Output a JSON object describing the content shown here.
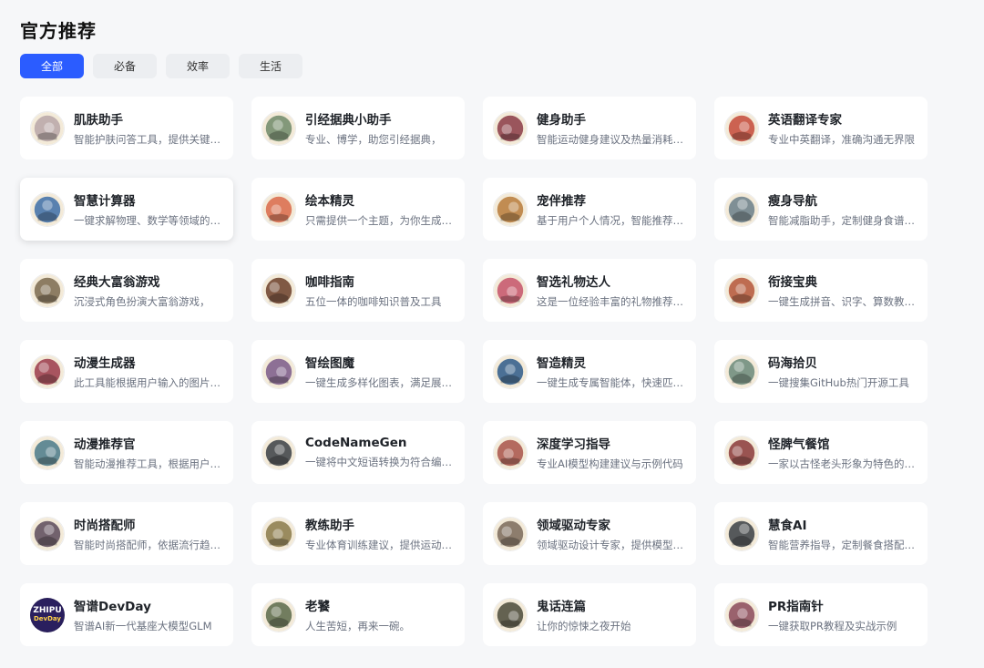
{
  "page": {
    "title": "官方推荐"
  },
  "tabs": [
    {
      "label": "全部",
      "active": true
    },
    {
      "label": "必备",
      "active": false
    },
    {
      "label": "效率",
      "active": false
    },
    {
      "label": "生活",
      "active": false
    }
  ],
  "cards": [
    {
      "name": "肌肤助手",
      "desc": "智能护肤问答工具，提供关键皮肤问题解答",
      "icon": "skin-care-icon",
      "color": "#b7a6a8"
    },
    {
      "name": "引经据典小助手",
      "desc": "专业、博学，助您引经据典，",
      "icon": "landscape-icon",
      "color": "#6f8a6a"
    },
    {
      "name": "健身助手",
      "desc": "智能运动健身建议及热量消耗计算",
      "icon": "fitness-icon",
      "color": "#8a3b47"
    },
    {
      "name": "英语翻译专家",
      "desc": "专业中英翻译，准确沟通无界限",
      "icon": "translate-icon",
      "color": "#c44a3a"
    },
    {
      "name": "智慧计算器",
      "desc": "一键求解物理、数学等领域的问题",
      "icon": "calculator-icon",
      "color": "#3d6ea8"
    },
    {
      "name": "绘本精灵",
      "desc": "只需提供一个主题，为你生成绘本",
      "icon": "picture-book-icon",
      "color": "#d96a4a"
    },
    {
      "name": "宠伴推荐",
      "desc": "基于用户个人情况，智能推荐宠物",
      "icon": "pet-icon",
      "color": "#b77b3b"
    },
    {
      "name": "瘦身导航",
      "desc": "智能减脂助手，定制健身食谱计划",
      "icon": "slim-icon",
      "color": "#6a7f8a"
    },
    {
      "name": "经典大富翁游戏",
      "desc": "沉浸式角色扮演大富翁游戏，",
      "icon": "monopoly-icon",
      "color": "#7a6a4f"
    },
    {
      "name": "咖啡指南",
      "desc": "五位一体的咖啡知识普及工具",
      "icon": "coffee-icon",
      "color": "#6b3f2a"
    },
    {
      "name": "智选礼物达人",
      "desc": "这是一位经验丰富的礼物推荐专家",
      "icon": "gift-icon",
      "color": "#c4536a"
    },
    {
      "name": "衔接宝典",
      "desc": "一键生成拼音、识字、算数教学材料",
      "icon": "textbook-icon",
      "color": "#b4563a"
    },
    {
      "name": "动漫生成器",
      "desc": "此工具能根据用户输入的图片生成动漫",
      "icon": "anime-generator-icon",
      "color": "#9a3a4a"
    },
    {
      "name": "智绘图魔",
      "desc": "一键生成多样化图表，满足展示需求",
      "icon": "chart-magic-icon",
      "color": "#7a5a8a"
    },
    {
      "name": "智造精灵",
      "desc": "一键生成专属智能体，快速匹配需求",
      "icon": "elf-icon",
      "color": "#2d5a8a"
    },
    {
      "name": "码海拾贝",
      "desc": "一键搜集GitHub热门开源工具",
      "icon": "shell-icon",
      "color": "#6a8a7a"
    },
    {
      "name": "动漫推荐官",
      "desc": "智能动漫推荐工具，根据用户喜好推荐",
      "icon": "anime-recommend-icon",
      "color": "#4a7a8a"
    },
    {
      "name": "CodeNameGen",
      "desc": "一键将中文短语转换为符合编程规范的命名",
      "icon": "code-icon",
      "color": "#3a3f45"
    },
    {
      "name": "深度学习指导",
      "desc": "专业AI模型构建建议与示例代码",
      "icon": "deep-learning-icon",
      "color": "#a8534a"
    },
    {
      "name": "怪脾气餐馆",
      "desc": "一家以古怪老头形象为特色的餐馆",
      "icon": "restaurant-icon",
      "color": "#8a3a3a"
    },
    {
      "name": "时尚搭配师",
      "desc": "智能时尚搭配师，依据流行趋势推荐",
      "icon": "fashion-icon",
      "color": "#5a4a5a"
    },
    {
      "name": "教练助手",
      "desc": "专业体育训练建议，提供运动指导",
      "icon": "coach-icon",
      "color": "#8a7a4a"
    },
    {
      "name": "领域驱动专家",
      "desc": "领域驱动设计专家，提供模型设计建议",
      "icon": "domain-icon",
      "color": "#7a6a5a"
    },
    {
      "name": "慧食AI",
      "desc": "智能营养指导，定制餐食搭配方案",
      "icon": "food-icon",
      "color": "#3a3f45"
    },
    {
      "name": "智谱DevDay",
      "desc": "智谱AI新一代基座大模型GLM",
      "icon": "zhipu-logo",
      "color": "#2a1f5e"
    },
    {
      "name": "老饕",
      "desc": "人生苦短，再来一碗。",
      "icon": "gourmet-icon",
      "color": "#5a6a4a"
    },
    {
      "name": "鬼话连篇",
      "desc": "让你的惊悚之夜开始",
      "icon": "ghost-icon",
      "color": "#4a4a3a"
    },
    {
      "name": "PR指南针",
      "desc": "一键获取PR教程及实战示例",
      "icon": "compass-icon",
      "color": "#8a4a5a"
    }
  ],
  "zhipu_logo": {
    "line1": "ZHIPU",
    "line2": "DevDay"
  }
}
